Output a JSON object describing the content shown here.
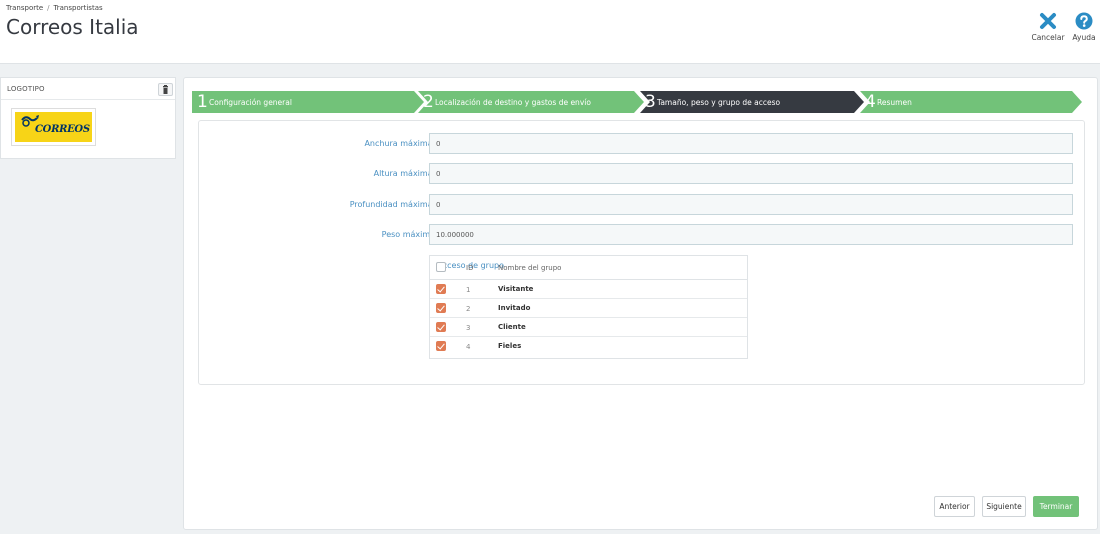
{
  "breadcrumb": {
    "items": [
      "Transporte",
      "Transportistas"
    ],
    "separator": "/"
  },
  "page_title": "Correos Italia",
  "toolbar": {
    "cancel_label": "Cancelar",
    "help_label": "Ayuda",
    "cancel_icon": "close-icon",
    "help_icon": "question-circle-icon"
  },
  "logo_panel": {
    "header": "LOGOTIPO",
    "delete_icon": "trash-icon",
    "logo_text": "CORREOS"
  },
  "steps": [
    {
      "number": "1",
      "label": "Configuración general",
      "state": "done"
    },
    {
      "number": "2",
      "label": "Localización de destino y gastos de envío",
      "state": "done"
    },
    {
      "number": "3",
      "label": "Tamaño, peso y grupo de acceso",
      "state": "current"
    },
    {
      "number": "4",
      "label": "Resumen",
      "state": "todo"
    }
  ],
  "form": {
    "fields": [
      {
        "label": "Anchura máxima del paquete (cm)",
        "value": "0"
      },
      {
        "label": "Altura máxima del paquete (cm)",
        "value": "0"
      },
      {
        "label": "Profundidad máxima del paquete (cm)",
        "value": "0"
      },
      {
        "label": "Peso máximo del paquete (kg)",
        "value": "10.000000"
      }
    ],
    "group_access": {
      "label": "Acceso de grupo",
      "columns": {
        "id": "ID",
        "name": "Nombre del grupo"
      },
      "select_all_checked": false,
      "rows": [
        {
          "id": "1",
          "name": "Visitante",
          "checked": true
        },
        {
          "id": "2",
          "name": "Invitado",
          "checked": true
        },
        {
          "id": "3",
          "name": "Cliente",
          "checked": true
        },
        {
          "id": "4",
          "name": "Fieles",
          "checked": true
        }
      ]
    }
  },
  "buttons": {
    "previous": "Anterior",
    "next": "Siguiente",
    "finish": "Terminar"
  },
  "colors": {
    "step_done": "#72c279",
    "step_current": "#363a41",
    "field_label": "#4a90c2",
    "checkbox_checked": "#e07b53",
    "finish_button": "#72c279"
  }
}
